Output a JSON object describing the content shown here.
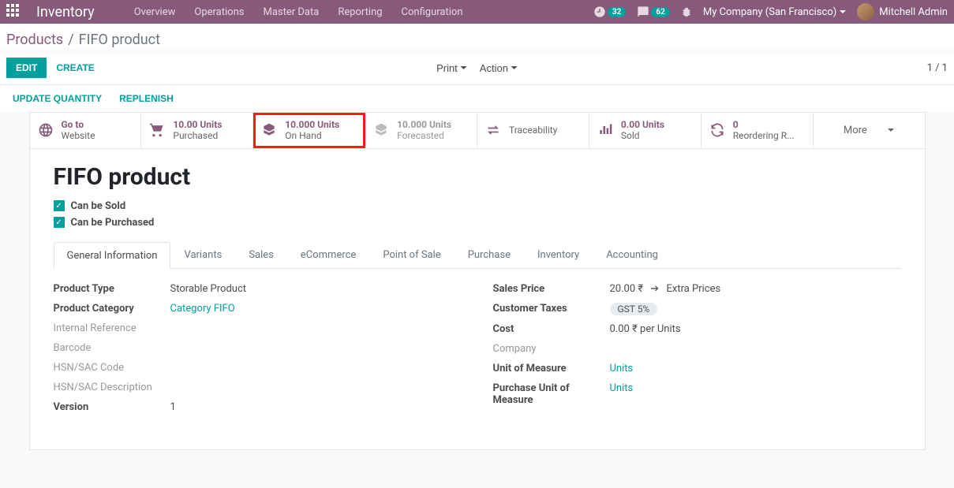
{
  "nav": {
    "brand": "Inventory",
    "links": [
      "Overview",
      "Operations",
      "Master Data",
      "Reporting",
      "Configuration"
    ],
    "clock_badge": "32",
    "chat_badge": "62",
    "company": "My Company (San Francisco)",
    "user": "Mitchell Admin"
  },
  "breadcrumb": {
    "root": "Products",
    "current": "FIFO product"
  },
  "actions": {
    "edit": "Edit",
    "create": "Create",
    "print": "Print",
    "action": "Action",
    "pager": "1 / 1"
  },
  "subactions": {
    "update_qty": "Update Quantity",
    "replenish": "Replenish"
  },
  "stats": {
    "website": {
      "l1": "Go to",
      "l2": "Website"
    },
    "purchased": {
      "l1": "10.00 Units",
      "l2": "Purchased"
    },
    "onhand": {
      "l1": "10.000 Units",
      "l2": "On Hand"
    },
    "forecasted": {
      "l1": "10.000 Units",
      "l2": "Forecasted"
    },
    "trace": {
      "l2": "Traceability"
    },
    "sold": {
      "l1": "0.00 Units",
      "l2": "Sold"
    },
    "reorder": {
      "l1": "0",
      "l2": "Reordering R..."
    },
    "more": "More"
  },
  "product": {
    "name": "FIFO product",
    "can_be_sold_label": "Can be Sold",
    "can_be_purchased_label": "Can be Purchased"
  },
  "tabs": [
    "General Information",
    "Variants",
    "Sales",
    "eCommerce",
    "Point of Sale",
    "Purchase",
    "Inventory",
    "Accounting"
  ],
  "fields": {
    "product_type_label": "Product Type",
    "product_type": "Storable Product",
    "product_category_label": "Product Category",
    "product_category": "Category FIFO",
    "internal_ref_label": "Internal Reference",
    "barcode_label": "Barcode",
    "hsn_code_label": "HSN/SAC Code",
    "hsn_desc_label": "HSN/SAC Description",
    "version_label": "Version",
    "version": "1",
    "sales_price_label": "Sales Price",
    "sales_price": "20.00 ₹",
    "extra_prices": "Extra Prices",
    "customer_taxes_label": "Customer Taxes",
    "customer_taxes": "GST 5%",
    "cost_label": "Cost",
    "cost": "0.00 ₹",
    "cost_suffix": "per Units",
    "company_label": "Company",
    "uom_label": "Unit of Measure",
    "uom": "Units",
    "puom_label": "Purchase Unit of Measure",
    "puom": "Units"
  }
}
